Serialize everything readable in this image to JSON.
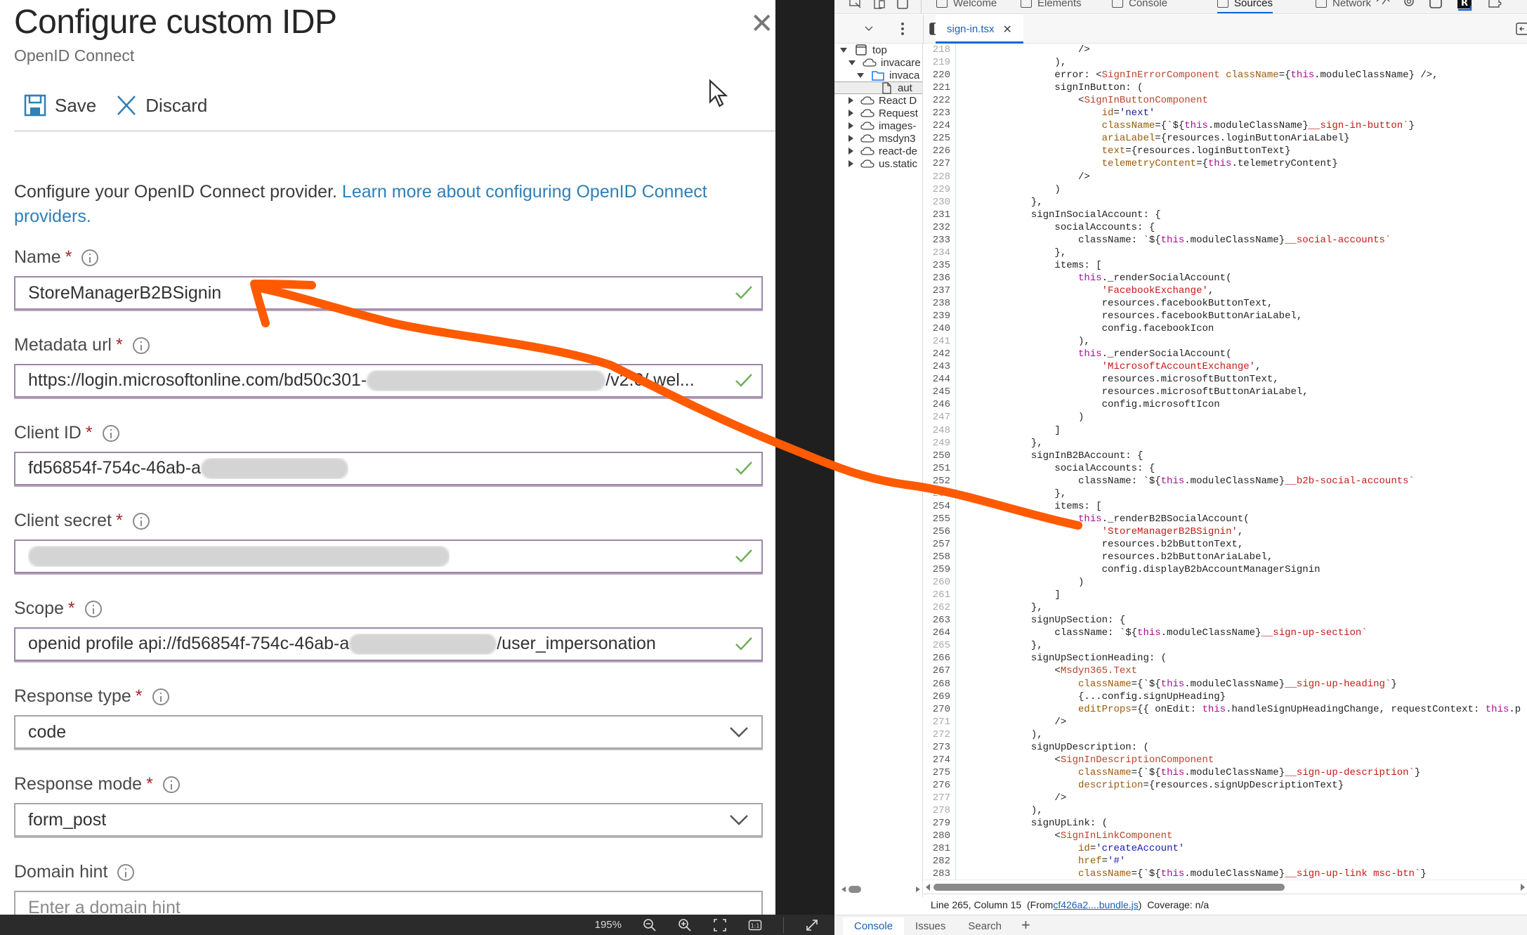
{
  "blade": {
    "title": "Configure custom IDP",
    "subtitle": "OpenID Connect",
    "commands": {
      "save": "Save",
      "discard": "Discard"
    },
    "intro_text": "Configure your OpenID Connect provider. ",
    "intro_link": "Learn more about configuring OpenID Connect providers.",
    "fields": {
      "name": {
        "label": "Name",
        "required": "*",
        "value": "StoreManagerB2BSignin"
      },
      "metadata_url": {
        "label": "Metadata url",
        "required": "*",
        "value_start": "https://login.microsoftonline.com/bd50c301-",
        "value_end": "/v2.0/.wel..."
      },
      "client_id": {
        "label": "Client ID",
        "required": "*",
        "value": "fd56854f-754c-46ab-a"
      },
      "client_secret": {
        "label": "Client secret",
        "required": "*",
        "value": ""
      },
      "scope": {
        "label": "Scope",
        "required": "*",
        "value_start": "openid profile api://fd56854f-754c-46ab-a",
        "value_end": "/user_impersonation"
      },
      "response_type": {
        "label": "Response type",
        "required": "*",
        "value": "code"
      },
      "response_mode": {
        "label": "Response mode",
        "required": "*",
        "value": "form_post"
      },
      "domain_hint": {
        "label": "Domain hint",
        "placeholder": "Enter a domain hint"
      }
    }
  },
  "viewer": {
    "zoom": "195%"
  },
  "devtools": {
    "tools": [
      {
        "label": "Welcome",
        "icon": "home-icon"
      },
      {
        "label": "Elements",
        "icon": "code-icon"
      },
      {
        "label": "Console",
        "icon": "terminal-icon"
      },
      {
        "label": "Sources",
        "icon": "bug-icon",
        "active": true
      },
      {
        "label": "Network",
        "icon": "wifi-icon"
      }
    ],
    "open_file": "sign-in.tsx",
    "tree": [
      {
        "label": "top",
        "depth": 0,
        "state": "down",
        "icon": "frame"
      },
      {
        "label": "invacare",
        "depth": 1,
        "state": "down",
        "icon": "cloud"
      },
      {
        "label": "invaca",
        "depth": 2,
        "state": "down",
        "icon": "folder"
      },
      {
        "label": "aut",
        "depth": 3,
        "state": "none",
        "icon": "file",
        "selected": true
      },
      {
        "label": "React D",
        "depth": 1,
        "state": "right",
        "icon": "cloud"
      },
      {
        "label": "Request",
        "depth": 1,
        "state": "right",
        "icon": "cloud"
      },
      {
        "label": "images-",
        "depth": 1,
        "state": "right",
        "icon": "cloud"
      },
      {
        "label": "msdyn3",
        "depth": 1,
        "state": "right",
        "icon": "cloud"
      },
      {
        "label": "react-de",
        "depth": 1,
        "state": "right",
        "icon": "cloud"
      },
      {
        "label": "us.static",
        "depth": 1,
        "state": "right",
        "icon": "cloud"
      }
    ],
    "code_lines": [
      {
        "n": 218,
        "indent": 20,
        "tokens": [
          [
            "p",
            "/>"
          ]
        ]
      },
      {
        "n": 219,
        "indent": 16,
        "tokens": [
          [
            "p",
            "),"
          ]
        ]
      },
      {
        "n": 220,
        "indent": 16,
        "tokens": [
          [
            "p",
            "error: <"
          ],
          [
            "t",
            "SignInErrorComponent"
          ],
          [
            "p",
            " "
          ],
          [
            "a",
            "className"
          ],
          [
            "p",
            "={"
          ],
          [
            "k",
            "this"
          ],
          [
            "p",
            ".moduleClassName} />,"
          ]
        ]
      },
      {
        "n": 221,
        "indent": 16,
        "tokens": [
          [
            "p",
            "signInButton: ("
          ]
        ]
      },
      {
        "n": 222,
        "indent": 20,
        "tokens": [
          [
            "p",
            "<"
          ],
          [
            "t",
            "SignInButtonComponent"
          ]
        ]
      },
      {
        "n": 223,
        "indent": 24,
        "tokens": [
          [
            "a",
            "id"
          ],
          [
            "p",
            "="
          ],
          [
            "c",
            "'next'"
          ]
        ]
      },
      {
        "n": 224,
        "indent": 24,
        "tokens": [
          [
            "a",
            "className"
          ],
          [
            "p",
            "={`${"
          ],
          [
            "k",
            "this"
          ],
          [
            "p",
            ".moduleClassName}"
          ],
          [
            "s",
            "__sign-in-button`"
          ],
          [
            "p",
            "}"
          ]
        ]
      },
      {
        "n": 225,
        "indent": 24,
        "tokens": [
          [
            "a",
            "ariaLabel"
          ],
          [
            "p",
            "={resources.loginButtonAriaLabel}"
          ]
        ]
      },
      {
        "n": 226,
        "indent": 24,
        "tokens": [
          [
            "a",
            "text"
          ],
          [
            "p",
            "={resources.loginButtonText}"
          ]
        ]
      },
      {
        "n": 227,
        "indent": 24,
        "tokens": [
          [
            "a",
            "telemetryContent"
          ],
          [
            "p",
            "={"
          ],
          [
            "k",
            "this"
          ],
          [
            "p",
            ".telemetryContent}"
          ]
        ]
      },
      {
        "n": 228,
        "indent": 20,
        "tokens": [
          [
            "p",
            "/>"
          ]
        ]
      },
      {
        "n": 229,
        "indent": 16,
        "tokens": [
          [
            "p",
            ")"
          ]
        ]
      },
      {
        "n": 230,
        "indent": 12,
        "tokens": [
          [
            "p",
            "},"
          ]
        ]
      },
      {
        "n": 231,
        "indent": 12,
        "tokens": [
          [
            "p",
            "signInSocialAccount: {"
          ]
        ]
      },
      {
        "n": 232,
        "indent": 16,
        "tokens": [
          [
            "p",
            "socialAccounts: {"
          ]
        ]
      },
      {
        "n": 233,
        "indent": 20,
        "tokens": [
          [
            "p",
            "className: `${"
          ],
          [
            "k",
            "this"
          ],
          [
            "p",
            ".moduleClassName}"
          ],
          [
            "s",
            "__social-accounts`"
          ]
        ]
      },
      {
        "n": 234,
        "indent": 16,
        "tokens": [
          [
            "p",
            "},"
          ]
        ]
      },
      {
        "n": 235,
        "indent": 16,
        "tokens": [
          [
            "p",
            "items: ["
          ]
        ]
      },
      {
        "n": 236,
        "indent": 20,
        "tokens": [
          [
            "k",
            "this"
          ],
          [
            "p",
            "._renderSocialAccount("
          ]
        ]
      },
      {
        "n": 237,
        "indent": 24,
        "tokens": [
          [
            "s",
            "'FacebookExchange'"
          ],
          [
            "p",
            ","
          ]
        ]
      },
      {
        "n": 238,
        "indent": 24,
        "tokens": [
          [
            "p",
            "resources.facebookButtonText,"
          ]
        ]
      },
      {
        "n": 239,
        "indent": 24,
        "tokens": [
          [
            "p",
            "resources.facebookButtonAriaLabel,"
          ]
        ]
      },
      {
        "n": 240,
        "indent": 24,
        "tokens": [
          [
            "p",
            "config.facebookIcon"
          ]
        ]
      },
      {
        "n": 241,
        "indent": 20,
        "tokens": [
          [
            "p",
            "),"
          ]
        ]
      },
      {
        "n": 242,
        "indent": 20,
        "tokens": [
          [
            "k",
            "this"
          ],
          [
            "p",
            "._renderSocialAccount("
          ]
        ]
      },
      {
        "n": 243,
        "indent": 24,
        "tokens": [
          [
            "s",
            "'MicrosoftAccountExchange'"
          ],
          [
            "p",
            ","
          ]
        ]
      },
      {
        "n": 244,
        "indent": 24,
        "tokens": [
          [
            "p",
            "resources.microsoftButtonText,"
          ]
        ]
      },
      {
        "n": 245,
        "indent": 24,
        "tokens": [
          [
            "p",
            "resources.microsoftButtonAriaLabel,"
          ]
        ]
      },
      {
        "n": 246,
        "indent": 24,
        "tokens": [
          [
            "p",
            "config.microsoftIcon"
          ]
        ]
      },
      {
        "n": 247,
        "indent": 20,
        "tokens": [
          [
            "p",
            ")"
          ]
        ]
      },
      {
        "n": 248,
        "indent": 16,
        "tokens": [
          [
            "p",
            "]"
          ]
        ]
      },
      {
        "n": 249,
        "indent": 12,
        "tokens": [
          [
            "p",
            "},"
          ]
        ]
      },
      {
        "n": 250,
        "indent": 12,
        "tokens": [
          [
            "p",
            "signInB2BAccount: {"
          ]
        ]
      },
      {
        "n": 251,
        "indent": 16,
        "tokens": [
          [
            "p",
            "socialAccounts: {"
          ]
        ]
      },
      {
        "n": 252,
        "indent": 20,
        "tokens": [
          [
            "p",
            "className: `${"
          ],
          [
            "k",
            "this"
          ],
          [
            "p",
            ".moduleClassName}"
          ],
          [
            "s",
            "__b2b-social-accounts`"
          ]
        ]
      },
      {
        "n": 253,
        "indent": 16,
        "tokens": [
          [
            "p",
            "},"
          ]
        ]
      },
      {
        "n": 254,
        "indent": 16,
        "tokens": [
          [
            "p",
            "items: ["
          ]
        ]
      },
      {
        "n": 255,
        "indent": 20,
        "tokens": [
          [
            "k",
            "this"
          ],
          [
            "p",
            "._renderB2BSocialAccount("
          ]
        ]
      },
      {
        "n": 256,
        "indent": 24,
        "tokens": [
          [
            "s",
            "'StoreManagerB2BSignin'"
          ],
          [
            "p",
            ","
          ]
        ]
      },
      {
        "n": 257,
        "indent": 24,
        "tokens": [
          [
            "p",
            "resources.b2bButtonText,"
          ]
        ]
      },
      {
        "n": 258,
        "indent": 24,
        "tokens": [
          [
            "p",
            "resources.b2bButtonAriaLabel,"
          ]
        ]
      },
      {
        "n": 259,
        "indent": 24,
        "tokens": [
          [
            "p",
            "config.displayB2bAccountManagerSignin"
          ]
        ]
      },
      {
        "n": 260,
        "indent": 20,
        "tokens": [
          [
            "p",
            ")"
          ]
        ]
      },
      {
        "n": 261,
        "indent": 16,
        "tokens": [
          [
            "p",
            "]"
          ]
        ]
      },
      {
        "n": 262,
        "indent": 12,
        "tokens": [
          [
            "p",
            "},"
          ]
        ]
      },
      {
        "n": 263,
        "indent": 12,
        "tokens": [
          [
            "p",
            "signUpSection: {"
          ]
        ]
      },
      {
        "n": 264,
        "indent": 16,
        "tokens": [
          [
            "p",
            "className: `${"
          ],
          [
            "k",
            "this"
          ],
          [
            "p",
            ".moduleClassName}"
          ],
          [
            "s",
            "__sign-up-section`"
          ]
        ]
      },
      {
        "n": 265,
        "indent": 12,
        "tokens": [
          [
            "p",
            "},"
          ]
        ]
      },
      {
        "n": 266,
        "indent": 12,
        "tokens": [
          [
            "p",
            "signUpSectionHeading: ("
          ]
        ]
      },
      {
        "n": 267,
        "indent": 16,
        "tokens": [
          [
            "p",
            "<"
          ],
          [
            "t",
            "Msdyn365.Text"
          ]
        ]
      },
      {
        "n": 268,
        "indent": 20,
        "tokens": [
          [
            "a",
            "className"
          ],
          [
            "p",
            "={`${"
          ],
          [
            "k",
            "this"
          ],
          [
            "p",
            ".moduleClassName}"
          ],
          [
            "s",
            "__sign-up-heading`"
          ],
          [
            "p",
            "}"
          ]
        ]
      },
      {
        "n": 269,
        "indent": 20,
        "tokens": [
          [
            "p",
            "{...config.signUpHeading}"
          ]
        ]
      },
      {
        "n": 270,
        "indent": 20,
        "tokens": [
          [
            "a",
            "editProps"
          ],
          [
            "p",
            "={{ onEdit: "
          ],
          [
            "k",
            "this"
          ],
          [
            "p",
            ".handleSignUpHeadingChange, requestContext: "
          ],
          [
            "k",
            "this"
          ],
          [
            "p",
            ".p"
          ]
        ]
      },
      {
        "n": 271,
        "indent": 16,
        "tokens": [
          [
            "p",
            "/>"
          ]
        ]
      },
      {
        "n": 272,
        "indent": 12,
        "tokens": [
          [
            "p",
            "),"
          ]
        ]
      },
      {
        "n": 273,
        "indent": 12,
        "tokens": [
          [
            "p",
            "signUpDescription: ("
          ]
        ]
      },
      {
        "n": 274,
        "indent": 16,
        "tokens": [
          [
            "p",
            "<"
          ],
          [
            "t",
            "SignInDescriptionComponent"
          ]
        ]
      },
      {
        "n": 275,
        "indent": 20,
        "tokens": [
          [
            "a",
            "className"
          ],
          [
            "p",
            "={`${"
          ],
          [
            "k",
            "this"
          ],
          [
            "p",
            ".moduleClassName}"
          ],
          [
            "s",
            "__sign-up-description`"
          ],
          [
            "p",
            "}"
          ]
        ]
      },
      {
        "n": 276,
        "indent": 20,
        "tokens": [
          [
            "a",
            "description"
          ],
          [
            "p",
            "={resources.signUpDescriptionText}"
          ]
        ]
      },
      {
        "n": 277,
        "indent": 16,
        "tokens": [
          [
            "p",
            "/>"
          ]
        ]
      },
      {
        "n": 278,
        "indent": 12,
        "tokens": [
          [
            "p",
            "),"
          ]
        ]
      },
      {
        "n": 279,
        "indent": 12,
        "tokens": [
          [
            "p",
            "signUpLink: ("
          ]
        ]
      },
      {
        "n": 280,
        "indent": 16,
        "tokens": [
          [
            "p",
            "<"
          ],
          [
            "t",
            "SignInLinkComponent"
          ]
        ]
      },
      {
        "n": 281,
        "indent": 20,
        "tokens": [
          [
            "a",
            "id"
          ],
          [
            "p",
            "="
          ],
          [
            "c",
            "'createAccount'"
          ]
        ]
      },
      {
        "n": 282,
        "indent": 20,
        "tokens": [
          [
            "a",
            "href"
          ],
          [
            "p",
            "="
          ],
          [
            "c",
            "'#'"
          ]
        ]
      },
      {
        "n": 283,
        "indent": 20,
        "tokens": [
          [
            "a",
            "className"
          ],
          [
            "p",
            "={`${"
          ],
          [
            "k",
            "this"
          ],
          [
            "p",
            ".moduleClassName}"
          ],
          [
            "s",
            "__sign-up-link msc-btn`"
          ],
          [
            "p",
            "}"
          ]
        ]
      }
    ],
    "dim_lines": [
      218,
      219,
      228,
      229,
      230,
      234,
      241,
      247,
      248,
      249,
      253,
      260,
      261,
      262,
      265,
      271,
      272,
      277,
      278
    ],
    "status": {
      "position": "Line 265, Column 15",
      "from_prefix": "(From ",
      "from_link": "cf426a2....bundle.js",
      "from_suffix": ")",
      "coverage": "Coverage: n/a"
    },
    "drawer_tabs": [
      "Console",
      "Issues",
      "Search"
    ]
  },
  "colors": {
    "accent": "#0b6ad4",
    "annotation": "#ff5a00",
    "required": "#a4262c",
    "valid": "#6fae5c",
    "link": "#2f7fb8"
  }
}
